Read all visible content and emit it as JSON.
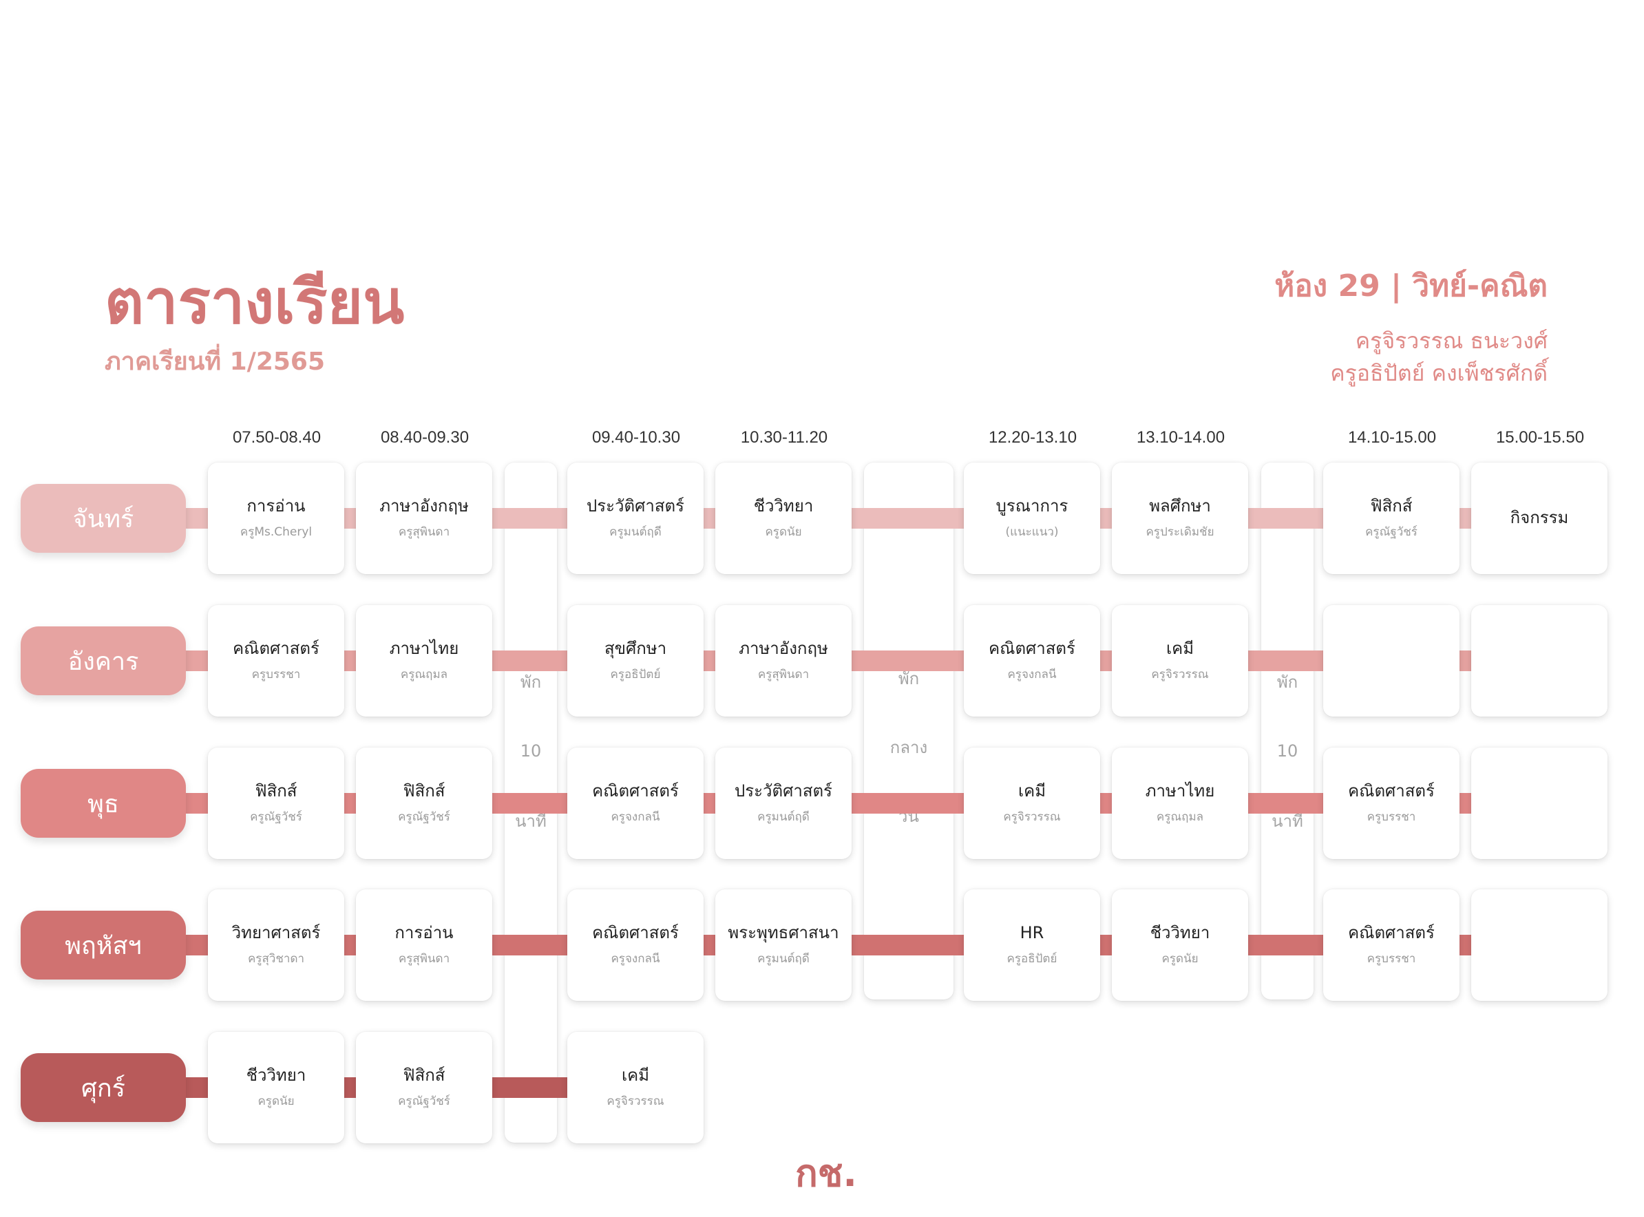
{
  "header": {
    "title": "ตารางเรียน",
    "subtitle": "ภาคเรียนที่ 1/2565",
    "room": "ห้อง 29 | วิทย์-คณิต",
    "teachers": [
      "ครูจิรวรรณ ธนะวงศ์",
      "ครูอธิปัตย์ คงเพ็ชรศักดิ์"
    ]
  },
  "times": [
    "07.50-08.40",
    "08.40-09.30",
    "09.40-10.30",
    "10.30-11.20",
    "12.20-13.10",
    "13.10-14.00",
    "14.10-15.00",
    "15.00-15.50"
  ],
  "days": [
    {
      "name": "จันทร์",
      "color": "#ebbcbb",
      "connector": "#ebbcbb",
      "cells": [
        {
          "subject": "การอ่าน",
          "teacher": "ครูMs.Cheryl"
        },
        {
          "subject": "ภาษาอังกฤษ",
          "teacher": "ครูสุพินดา"
        },
        {
          "subject": "ประวัติศาสตร์",
          "teacher": "ครูมนต์ฤดี"
        },
        {
          "subject": "ชีววิทยา",
          "teacher": "ครูดนัย"
        },
        {
          "subject": "บูรณาการ",
          "teacher": "(แนะแนว)"
        },
        {
          "subject": "พลศึกษา",
          "teacher": "ครูประเดิมชัย"
        },
        {
          "subject": "ฟิสิกส์",
          "teacher": "ครูณัฐวัชร์"
        },
        {
          "subject": "กิจกรรม",
          "teacher": ""
        }
      ]
    },
    {
      "name": "อังคาร",
      "color": "#e6a3a1",
      "connector": "#e6a3a1",
      "cells": [
        {
          "subject": "คณิตศาสตร์",
          "teacher": "ครูบรรชา"
        },
        {
          "subject": "ภาษาไทย",
          "teacher": "ครูณฤมล"
        },
        {
          "subject": "สุขศึกษา",
          "teacher": "ครูอธิปัตย์"
        },
        {
          "subject": "ภาษาอังกฤษ",
          "teacher": "ครูสุพินดา"
        },
        {
          "subject": "คณิตศาสตร์",
          "teacher": "ครูจงกลนี"
        },
        {
          "subject": "เคมี",
          "teacher": "ครูจิรวรรณ"
        },
        {
          "subject": "",
          "teacher": ""
        },
        {
          "subject": "",
          "teacher": ""
        }
      ]
    },
    {
      "name": "พุธ",
      "color": "#e08786",
      "connector": "#e08786",
      "cells": [
        {
          "subject": "ฟิสิกส์",
          "teacher": "ครูณัฐวัชร์"
        },
        {
          "subject": "ฟิสิกส์",
          "teacher": "ครูณัฐวัชร์"
        },
        {
          "subject": "คณิตศาสตร์",
          "teacher": "ครูจงกลนี"
        },
        {
          "subject": "ประวัติศาสตร์",
          "teacher": "ครูมนต์ฤดี"
        },
        {
          "subject": "เคมี",
          "teacher": "ครูจิรวรรณ"
        },
        {
          "subject": "ภาษาไทย",
          "teacher": "ครูณฤมล"
        },
        {
          "subject": "คณิตศาสตร์",
          "teacher": "ครูบรรชา"
        },
        {
          "subject": "",
          "teacher": ""
        }
      ]
    },
    {
      "name": "พฤหัสฯ",
      "color": "#d07271",
      "connector": "#d07271",
      "cells": [
        {
          "subject": "วิทยาศาสตร์",
          "teacher": "ครูสุวิชาดา"
        },
        {
          "subject": "การอ่าน",
          "teacher": "ครูสุพินดา"
        },
        {
          "subject": "คณิตศาสตร์",
          "teacher": "ครูจงกลนี"
        },
        {
          "subject": "พระพุทธศาสนา",
          "teacher": "ครูมนต์ฤดี"
        },
        {
          "subject": "HR",
          "teacher": "ครูอธิปัตย์"
        },
        {
          "subject": "ชีววิทยา",
          "teacher": "ครูดนัย"
        },
        {
          "subject": "คณิตศาสตร์",
          "teacher": "ครูบรรชา"
        },
        {
          "subject": "",
          "teacher": ""
        }
      ]
    },
    {
      "name": "ศุกร์",
      "color": "#b85a5a",
      "connector": "#b85a5a",
      "cells": [
        {
          "subject": "ชีววิทยา",
          "teacher": "ครูดนัย"
        },
        {
          "subject": "ฟิสิกส์",
          "teacher": "ครูณัฐวัชร์"
        },
        {
          "subject": "เคมี",
          "teacher": "ครูจิรวรรณ"
        }
      ]
    }
  ],
  "breaks": {
    "morning": [
      "พัก",
      "10",
      "นาที"
    ],
    "lunch": [
      "พัก",
      "กลาง",
      "วัน"
    ],
    "afternoon": [
      "พัก",
      "10",
      "นาที"
    ]
  },
  "footer_logo": "กช."
}
